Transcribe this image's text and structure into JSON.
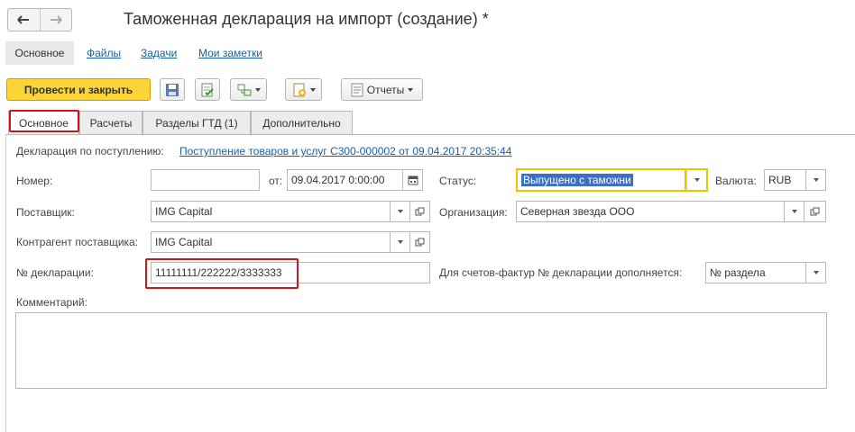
{
  "header": {
    "title": "Таможенная декларация на импорт (создание) *"
  },
  "sections": {
    "active": "Основное",
    "links": [
      "Файлы",
      "Задачи",
      "Мои заметки"
    ]
  },
  "toolbar": {
    "post_close_label": "Провести и закрыть",
    "reports_label": "Отчеты",
    "colors": {
      "primary": "#fbd535"
    }
  },
  "tabs": [
    "Основное",
    "Расчеты",
    "Разделы ГТД (1)",
    "Дополнительно"
  ],
  "form": {
    "basis": {
      "label": "Декларация по поступлению:",
      "link": "Поступление товаров и услуг С300-000002 от 09.04.2017 20:35:44"
    },
    "number": {
      "label": "Номер:",
      "value": ""
    },
    "date": {
      "label": "от:",
      "value": "09.04.2017  0:00:00"
    },
    "status": {
      "label": "Статус:",
      "value": "Выпущено с таможни"
    },
    "currency": {
      "label": "Валюта:",
      "value": "RUB"
    },
    "supplier": {
      "label": "Поставщик:",
      "value": "IMG Capital"
    },
    "organization": {
      "label": "Организация:",
      "value": "Северная звезда ООО"
    },
    "counterparty": {
      "label": "Контрагент поставщика:",
      "value": "IMG Capital"
    },
    "declaration_no": {
      "label": "№ декларации:",
      "value": "11111111/222222/3333333"
    },
    "invoice_suffix": {
      "label": "Для счетов-фактур № декларации дополняется:",
      "value": "№ раздела"
    },
    "comment": {
      "label": "Комментарий:",
      "value": ""
    }
  },
  "icons": [
    "back-arrow-icon",
    "forward-arrow-icon",
    "save-icon",
    "post-icon",
    "structure-icon",
    "create-based-icon",
    "reports-icon",
    "calendar-icon",
    "open-icon"
  ]
}
